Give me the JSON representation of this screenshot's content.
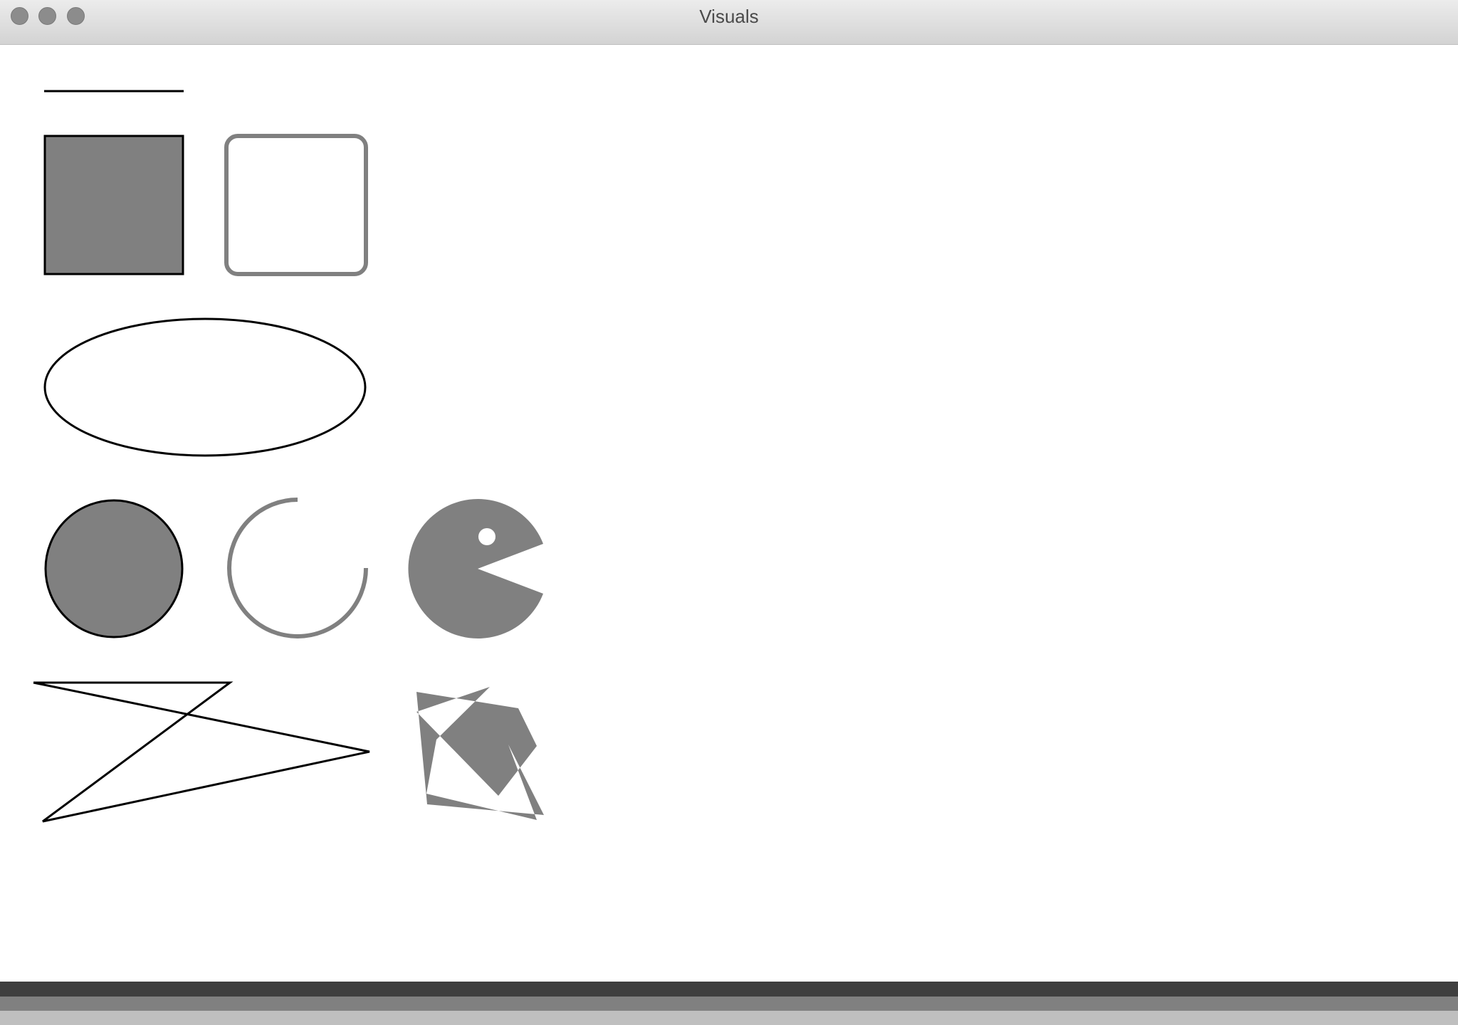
{
  "window": {
    "title": "Visuals"
  },
  "colors": {
    "stroke_dark": "#000000",
    "fill_gray": "#808080",
    "background": "#ffffff",
    "band_dark": "#3f3f3f",
    "band_mid": "#808080",
    "band_light": "#bfbfbf"
  },
  "shapes": [
    "line",
    "filled-rectangle",
    "rounded-rectangle-outline",
    "ellipse-outline",
    "filled-circle",
    "arc-outline",
    "pacman-pie",
    "polyline-outline",
    "filled-polygon-star"
  ],
  "arc": {
    "sweep_degrees": 270
  },
  "pacman": {
    "mouth_degrees": 45
  }
}
